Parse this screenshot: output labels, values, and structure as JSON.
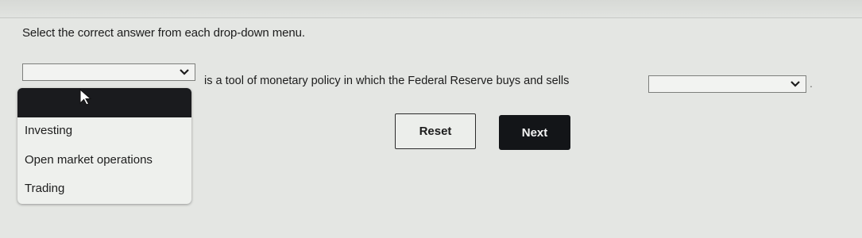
{
  "question": {
    "instruction": "Select the correct answer from each drop-down menu.",
    "sentence_middle": "is a tool of monetary policy in which the Federal Reserve buys and sells",
    "sentence_end": "."
  },
  "dropdown1": {
    "selected": "",
    "options": [
      "Investing",
      "Open market operations",
      "Trading"
    ]
  },
  "dropdown2": {
    "selected": ""
  },
  "buttons": {
    "reset": "Reset",
    "next": "Next"
  },
  "icons": {
    "dropdown_arrow": "chevron-down-icon",
    "cursor": "mouse-pointer-icon"
  }
}
